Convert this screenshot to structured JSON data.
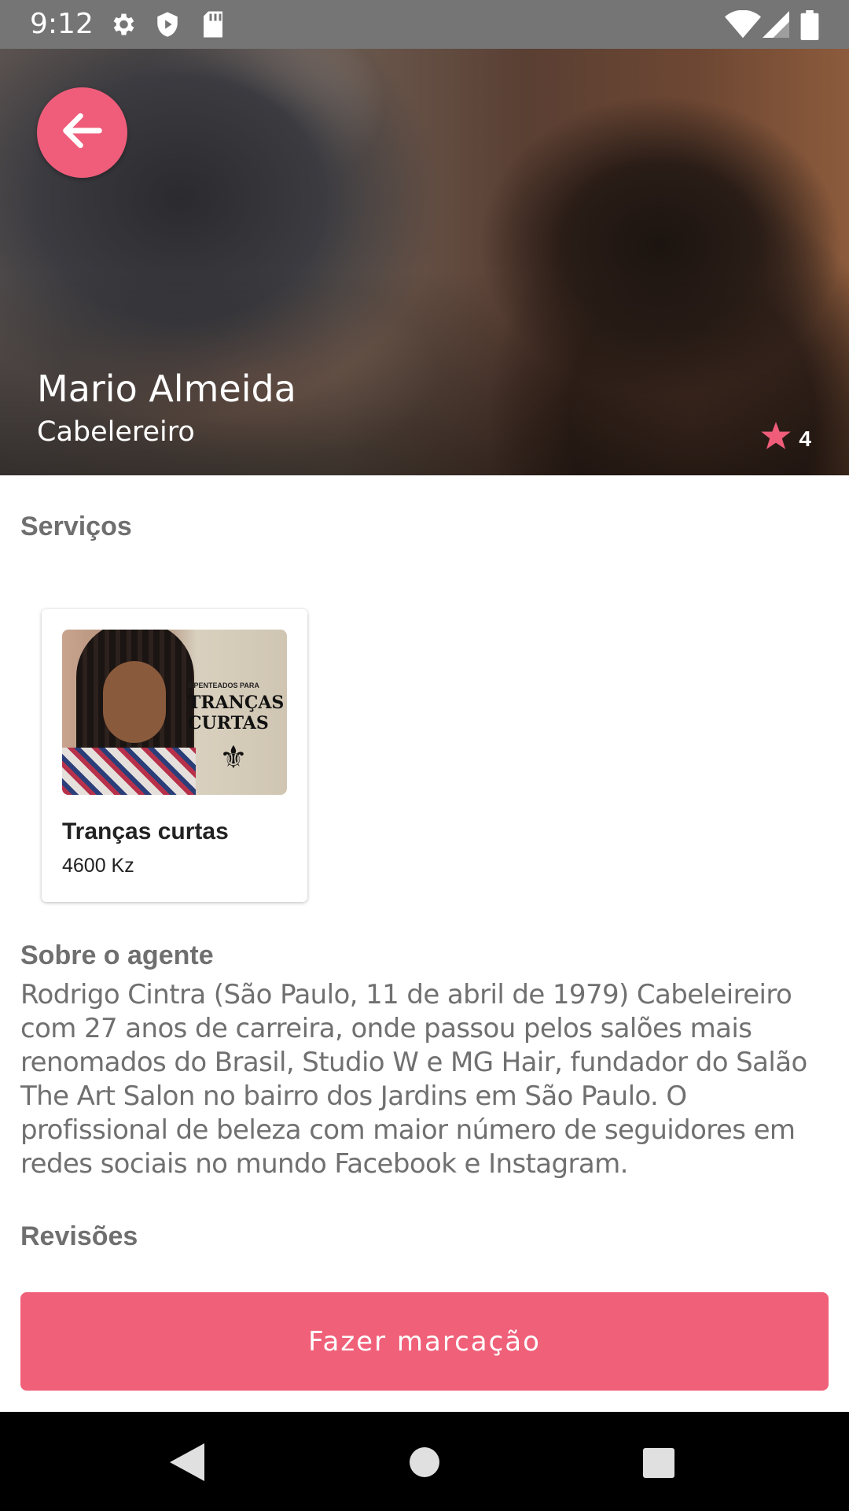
{
  "status_bar": {
    "time": "9:12",
    "left_icons": [
      "gear-icon",
      "shield-icon",
      "sd-card-icon"
    ],
    "right_icons": [
      "wifi-icon",
      "signal-icon",
      "battery-icon"
    ]
  },
  "header": {
    "back_icon": "arrow-left-icon",
    "agent_name": "Mario Almeida",
    "agent_role": "Cabelereiro",
    "rating_icon": "star-icon",
    "rating": "4"
  },
  "services": {
    "title": "Serviços",
    "items": [
      {
        "name": "Tranças curtas",
        "price": "4600 Kz",
        "image_text_small": "5 PENTEADOS PARA",
        "image_text_big": [
          "TRANÇAS",
          "CURTAS"
        ]
      }
    ]
  },
  "about": {
    "title": "Sobre o agente",
    "text": "Rodrigo Cintra (São Paulo, 11 de abril de 1979) Cabeleireiro com 27 anos de carreira, onde passou pelos salões mais renomados do Brasil, Studio W e MG Hair, fundador do Salão The Art Salon no bairro dos Jardins em São Paulo. O profissional de beleza com maior número de seguidores em redes sociais no mundo Facebook e Instagram."
  },
  "reviews": {
    "title": "Revisões"
  },
  "book_button": {
    "label": "Fazer marcação"
  },
  "nav_bar": {
    "icons": [
      "back-triangle-icon",
      "home-circle-icon",
      "recents-square-icon"
    ]
  },
  "colors": {
    "accent": "#ef5d7a",
    "status_bar": "#757575",
    "section_title": "#6f6f6f"
  }
}
